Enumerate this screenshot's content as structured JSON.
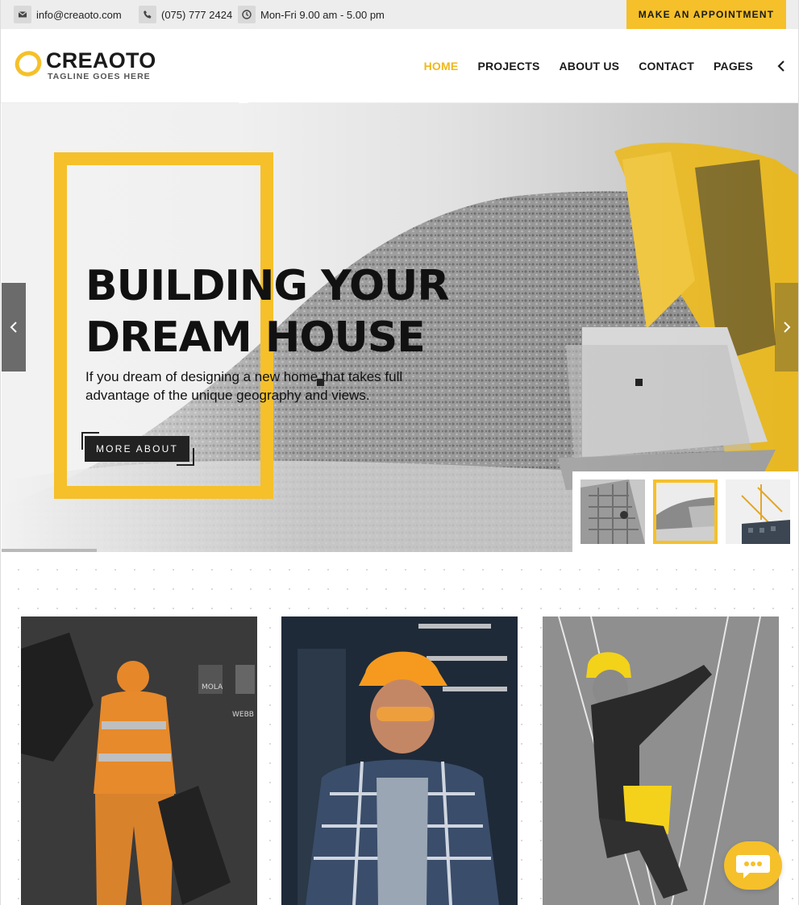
{
  "topbar": {
    "email": "info@creaoto.com",
    "phone": "(075) 777 2424",
    "hours": "Mon-Fri 9.00 am - 5.00 pm",
    "appointment_label": "MAKE AN APPOINTMENT",
    "icons": [
      "envelope-icon",
      "phone-icon",
      "clock-icon"
    ]
  },
  "header": {
    "logo_name": "CREAOTO",
    "logo_tagline": "TAGLINE GOES HERE",
    "nav": [
      {
        "label": "HOME",
        "active": true
      },
      {
        "label": "PROJECTS",
        "active": false
      },
      {
        "label": "ABOUT US",
        "active": false
      },
      {
        "label": "CONTACT",
        "active": false
      },
      {
        "label": "PAGES",
        "active": false
      }
    ]
  },
  "hero": {
    "title": "BUILDING YOUR\nDREAM HOUSE",
    "subtitle": "If you dream of designing a new home that takes full advantage of the unique geography and views.",
    "button_label": "MORE ABOUT",
    "thumbnails": [
      {
        "name": "climber-building",
        "active": false
      },
      {
        "name": "excavator",
        "active": true
      },
      {
        "name": "cranes",
        "active": false
      }
    ]
  },
  "cards": [
    {
      "name": "crane-supervisor"
    },
    {
      "name": "engineer-hardhat"
    },
    {
      "name": "rope-climber"
    }
  ],
  "colors": {
    "accent": "#f5c02a",
    "dark": "#1a1a1a",
    "topbar_bg": "#ededed"
  }
}
